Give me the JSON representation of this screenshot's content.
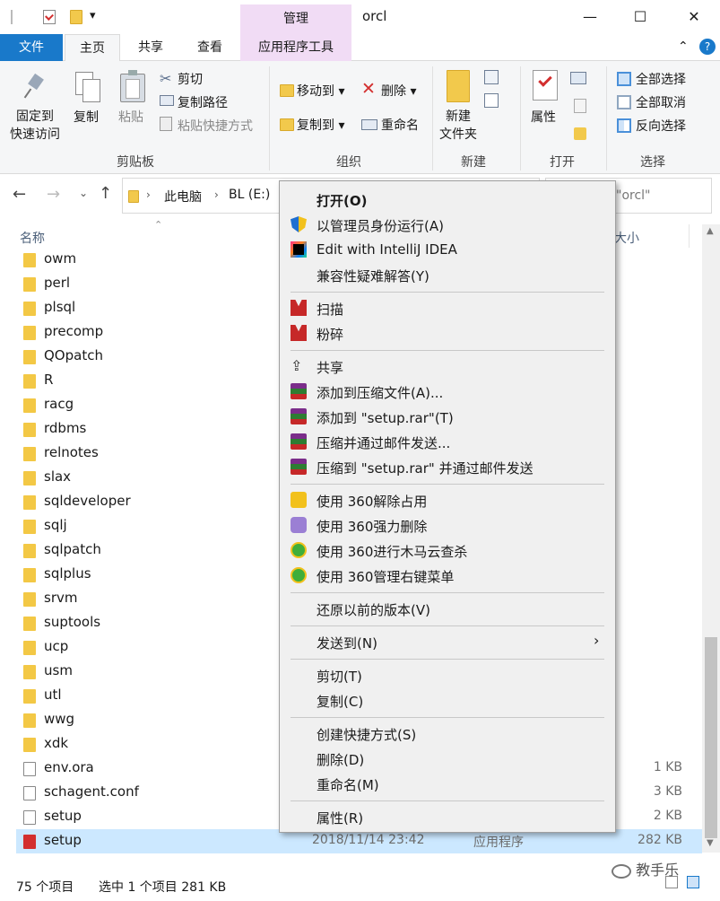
{
  "titlebar": {
    "manage_tab": "管理",
    "window_title": "orcl",
    "quick_access_dropdown": "▾",
    "minimize": "—",
    "maximize": "☐",
    "close": "✕"
  },
  "tabs": {
    "file": "文件",
    "home": "主页",
    "share": "共享",
    "view": "查看",
    "app_tools": "应用程序工具",
    "collapse": "⌃",
    "help": "?"
  },
  "ribbon": {
    "clipboard": {
      "pin_line1": "固定到",
      "pin_line2": "快速访问",
      "copy": "复制",
      "paste": "粘贴",
      "cut": "剪切",
      "copy_path": "复制路径",
      "paste_shortcut": "粘贴快捷方式",
      "group_label": "剪贴板"
    },
    "organize": {
      "move_to": "移动到",
      "copy_to": "复制到",
      "delete": "删除",
      "rename": "重命名",
      "group_label": "组织"
    },
    "new": {
      "new_folder_line1": "新建",
      "new_folder_line2": "文件夹",
      "group_label": "新建"
    },
    "open": {
      "properties": "属性",
      "group_label": "打开"
    },
    "select": {
      "select_all": "全部选择",
      "select_none": "全部取消",
      "invert": "反向选择",
      "group_label": "选择"
    }
  },
  "address": {
    "crumb1": "此电脑",
    "crumb2": "BL (E:)",
    "search_hint": "\"orcl\""
  },
  "columns": {
    "name": "名称",
    "size": "大小"
  },
  "files": [
    {
      "name": "owm",
      "kind": "folder",
      "size": ""
    },
    {
      "name": "perl",
      "kind": "folder",
      "size": ""
    },
    {
      "name": "plsql",
      "kind": "folder",
      "size": ""
    },
    {
      "name": "precomp",
      "kind": "folder",
      "size": ""
    },
    {
      "name": "QOpatch",
      "kind": "folder",
      "size": ""
    },
    {
      "name": "R",
      "kind": "folder",
      "size": ""
    },
    {
      "name": "racg",
      "kind": "folder",
      "size": ""
    },
    {
      "name": "rdbms",
      "kind": "folder",
      "size": ""
    },
    {
      "name": "relnotes",
      "kind": "folder",
      "size": ""
    },
    {
      "name": "slax",
      "kind": "folder",
      "size": ""
    },
    {
      "name": "sqldeveloper",
      "kind": "folder",
      "size": ""
    },
    {
      "name": "sqlj",
      "kind": "folder",
      "size": ""
    },
    {
      "name": "sqlpatch",
      "kind": "folder",
      "size": ""
    },
    {
      "name": "sqlplus",
      "kind": "folder",
      "size": ""
    },
    {
      "name": "srvm",
      "kind": "folder",
      "size": ""
    },
    {
      "name": "suptools",
      "kind": "folder",
      "size": ""
    },
    {
      "name": "ucp",
      "kind": "folder",
      "size": ""
    },
    {
      "name": "usm",
      "kind": "folder",
      "size": ""
    },
    {
      "name": "utl",
      "kind": "folder",
      "size": ""
    },
    {
      "name": "wwg",
      "kind": "folder",
      "size": ""
    },
    {
      "name": "xdk",
      "kind": "folder",
      "size": ""
    },
    {
      "name": "env.ora",
      "kind": "doc",
      "size": "1 KB"
    },
    {
      "name": "schagent.conf",
      "kind": "doc",
      "size": "3 KB"
    },
    {
      "name": "setup",
      "kind": "config",
      "size": "2 KB"
    },
    {
      "name": "setup",
      "kind": "exe",
      "date": "2018/11/14 23:42",
      "type": "应用程序",
      "size": "282 KB",
      "selected": true
    }
  ],
  "status": {
    "count": "75 个项目",
    "selection": "选中 1 个项目  281 KB"
  },
  "watermark": "教手乐",
  "context_menu": {
    "open": "打开(O)",
    "run_as_admin": "以管理员身份运行(A)",
    "edit_intellij": "Edit with IntelliJ IDEA",
    "compat": "兼容性疑难解答(Y)",
    "scan": "扫描",
    "shred": "粉碎",
    "share": "共享",
    "add_archive": "添加到压缩文件(A)...",
    "add_rar": "添加到 \"setup.rar\"(T)",
    "compress_email": "压缩并通过邮件发送...",
    "compress_rar_email": "压缩到 \"setup.rar\" 并通过邮件发送",
    "q360_unlock": "使用 360解除占用",
    "q360_delete": "使用 360强力删除",
    "q360_scan": "使用 360进行木马云查杀",
    "q360_menu": "使用 360管理右键菜单",
    "restore": "还原以前的版本(V)",
    "send_to": "发送到(N)",
    "cut": "剪切(T)",
    "copy": "复制(C)",
    "create_shortcut": "创建快捷方式(S)",
    "delete": "删除(D)",
    "rename": "重命名(M)",
    "properties": "属性(R)"
  }
}
